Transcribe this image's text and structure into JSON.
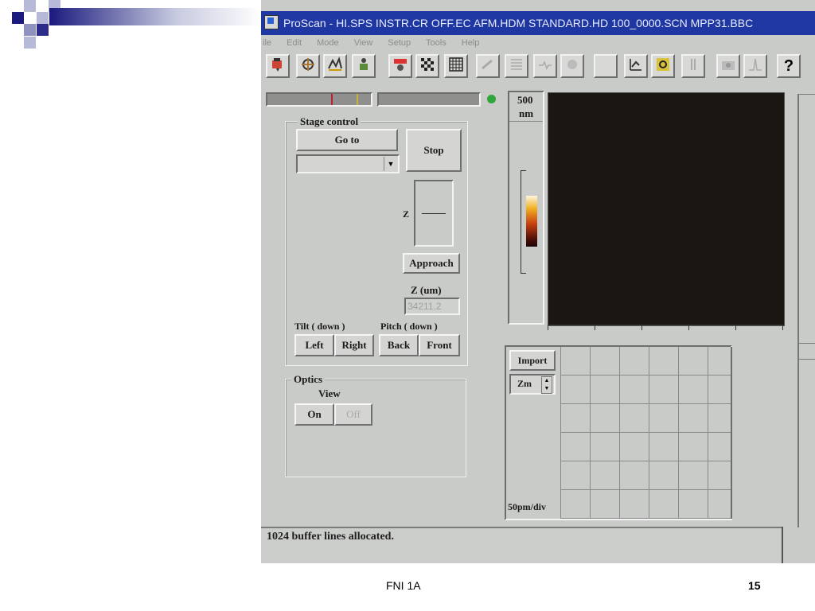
{
  "window": {
    "title": "ProScan - HI.SPS INSTR.CR OFF.EC AFM.HDM STANDARD.HD 100_0000.SCN MPP31.BBC"
  },
  "menu": [
    "ile",
    "Edit",
    "Mode",
    "View",
    "Setup",
    "Tools",
    "Help"
  ],
  "toolbar": {
    "help_label": "?"
  },
  "stage_control": {
    "title": "Stage control",
    "goto_label": "Go to",
    "stop_label": "Stop",
    "z_axis_label": "Z",
    "approach_label": "Approach",
    "z_um_label": "Z (um)",
    "z_um_value": "34211.2",
    "tilt_label": "Tilt ( down )",
    "pitch_label": "Pitch ( down )",
    "left_label": "Left",
    "right_label": "Right",
    "back_label": "Back",
    "front_label": "Front"
  },
  "optics": {
    "title": "Optics",
    "view_label": "View",
    "on_label": "On",
    "off_label": "Off"
  },
  "image_panel": {
    "scale_value": "500",
    "scale_unit": "nm"
  },
  "line_panel": {
    "import_label": "Import",
    "zm_label": "Zm",
    "scale_label": "50pm/div"
  },
  "status_bar": {
    "message": "1024 buffer lines allocated."
  },
  "slide": {
    "footer_center": "FNI 1A",
    "page_number": "15"
  },
  "colors": {
    "titlebar": "#1e37a2",
    "panel": "#c9cbc8",
    "image_bg": "#1a1612",
    "indicator": "#2fa63a"
  }
}
